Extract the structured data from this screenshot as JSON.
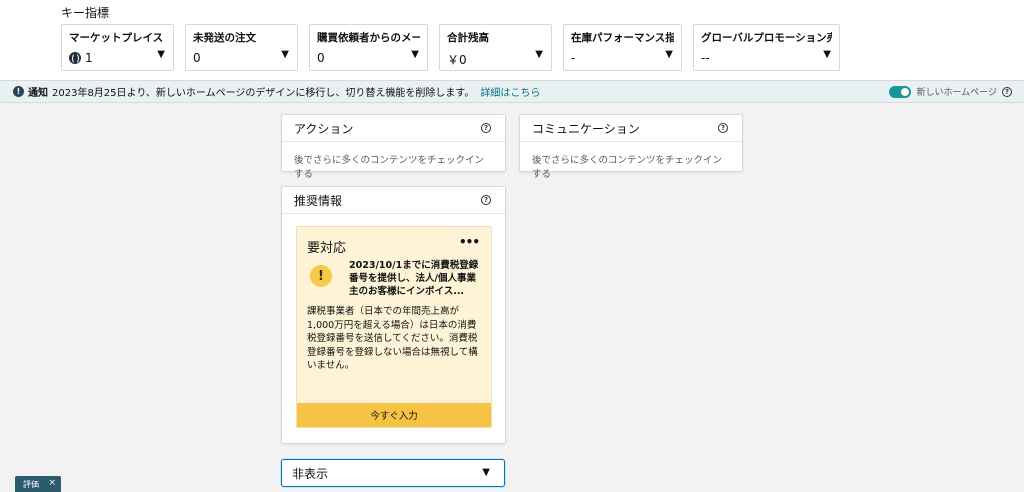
{
  "key_metrics": {
    "title": "キー指標",
    "items": [
      {
        "label": "マーケットプレイス",
        "value": "1"
      },
      {
        "label": "未発送の注文",
        "value": "0"
      },
      {
        "label": "購買依頼者からのメール",
        "value": "0"
      },
      {
        "label": "合計残高",
        "value": "￥0"
      },
      {
        "label": "在庫パフォーマンス指標",
        "value": "-"
      },
      {
        "label": "グローバルプロモーション売上",
        "value": "--"
      }
    ]
  },
  "notice": {
    "label": "通知",
    "text": "2023年8月25日より、新しいホームページのデザインに移行し、切り替え機能を削除します。",
    "link": "詳細はこちら",
    "toggle_label": "新しいホームページ"
  },
  "cards": {
    "actions": {
      "title": "アクション",
      "message": "後でさらに多くのコンテンツをチェックインする"
    },
    "communication": {
      "title": "コミュニケーション",
      "message": "後でさらに多くのコンテンツをチェックインする"
    },
    "recommendations": {
      "title": "推奨情報",
      "box_title": "要対応",
      "headline": "2023/10/1までに消費税登録番号を提供し、法人/個人事業主のお客様にインボイス...",
      "description": "課税事業者（日本での年間売上高が1,000万円を超える場合）は日本の消費税登録番号を送信してください。消費税登録番号を登録しない場合は無視して構いません。",
      "button": "今すぐ入力"
    }
  },
  "hide_select": {
    "value": "非表示"
  },
  "feedback": {
    "label": "評価"
  },
  "colors": {
    "accent": "#007185",
    "toggle": "#16979a",
    "alert_bg": "#fef3d6",
    "cta": "#f7c344"
  }
}
